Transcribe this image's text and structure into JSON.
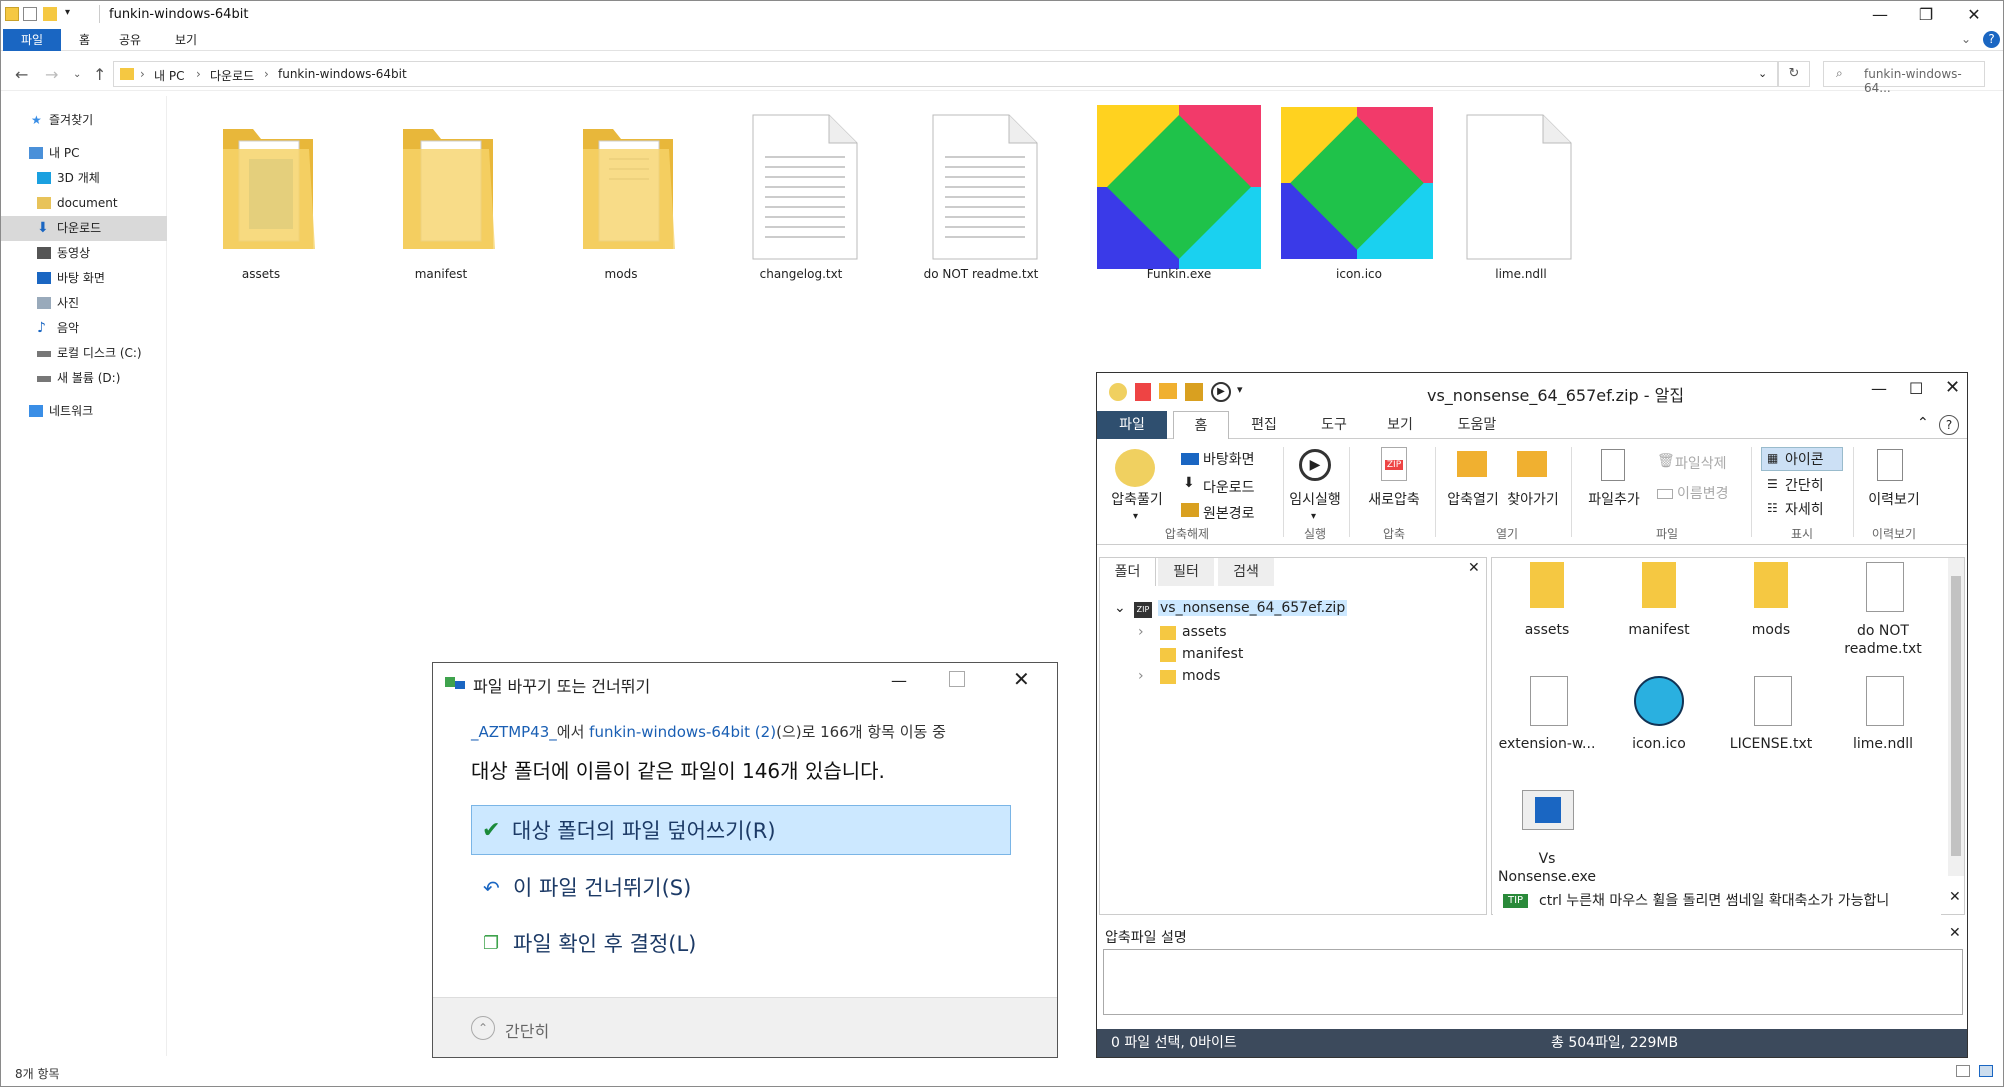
{
  "explorer": {
    "title": "funkin-windows-64bit",
    "ribbon_tabs": [
      "파일",
      "홈",
      "공유",
      "보기"
    ],
    "breadcrumb": [
      "내 PC",
      "다운로드",
      "funkin-windows-64bit"
    ],
    "search_placeholder": "funkin-windows-64...",
    "nav_items": [
      {
        "label": "즐겨찾기",
        "icon": "star-icon",
        "color": "#3a8ee6"
      },
      {
        "label": "내 PC",
        "icon": "pc-icon",
        "color": "#4a90d9"
      },
      {
        "label": "3D 개체",
        "icon": "cube-icon",
        "color": "#1aa0e0"
      },
      {
        "label": "document",
        "icon": "folder-icon",
        "color": "#e8c35a"
      },
      {
        "label": "다운로드",
        "icon": "download-icon",
        "color": "#1a66c2"
      },
      {
        "label": "동영상",
        "icon": "video-icon",
        "color": "#555"
      },
      {
        "label": "바탕 화면",
        "icon": "desktop-icon",
        "color": "#1a66c2"
      },
      {
        "label": "사진",
        "icon": "picture-icon",
        "color": "#888"
      },
      {
        "label": "음악",
        "icon": "music-icon",
        "color": "#1a66c2"
      },
      {
        "label": "로컬 디스크 (C:)",
        "icon": "drive-icon",
        "color": "#777"
      },
      {
        "label": "새 볼륨 (D:)",
        "icon": "drive-icon",
        "color": "#777"
      },
      {
        "label": "네트워크",
        "icon": "network-icon",
        "color": "#3a8ee6"
      }
    ],
    "files": [
      {
        "name": "assets",
        "type": "folder"
      },
      {
        "name": "manifest",
        "type": "folder"
      },
      {
        "name": "mods",
        "type": "folder"
      },
      {
        "name": "changelog.txt",
        "type": "text"
      },
      {
        "name": "do NOT readme.txt",
        "type": "text"
      },
      {
        "name": "Funkin.exe",
        "type": "exe"
      },
      {
        "name": "icon.ico",
        "type": "ico"
      },
      {
        "name": "lime.ndll",
        "type": "blank"
      }
    ],
    "status": "8개 항목"
  },
  "dialog": {
    "title": "파일 바꾸기 또는 건너뛰기",
    "source": "_AZTMP43_",
    "middle1": "에서",
    "target": "funkin-windows-64bit (2)",
    "middle2": "(으)로 166개 항목 이동 중",
    "message": "대상 폴더에 이름이 같은 파일이 146개 있습니다.",
    "options": [
      "대상 폴더의 파일 덮어쓰기(R)",
      "이 파일 건너뛰기(S)",
      "파일 확인 후 결정(L)"
    ],
    "collapse_label": "간단히"
  },
  "bandizip": {
    "title": "vs_nonsense_64_657ef.zip - 알집",
    "tabs": [
      "파일",
      "홈",
      "편집",
      "도구",
      "보기",
      "도움말"
    ],
    "ribbon": {
      "extract": "압축풀기",
      "to_desktop": "바탕화면",
      "to_downloads": "다운로드",
      "to_original": "원본경로",
      "group_extract": "압축해제",
      "temp_run": "임시실행",
      "group_run": "실행",
      "new_archive": "새로압축",
      "group_compress": "압축",
      "open_folder": "압축열기",
      "find": "찾아가기",
      "group_open": "열기",
      "add_file": "파일추가",
      "delete_file": "파일삭제",
      "rename": "이름변경",
      "group_file": "파일",
      "view_icon": "아이콘",
      "view_simple": "간단히",
      "view_detail": "자세히",
      "group_view": "표시",
      "history": "이력보기",
      "group_history": "이력보기"
    },
    "pane_tabs": [
      "폴더",
      "필터",
      "검색"
    ],
    "tree_root": "vs_nonsense_64_657ef.zip",
    "tree_children": [
      "assets",
      "manifest",
      "mods"
    ],
    "items": [
      {
        "name": "assets",
        "type": "folder"
      },
      {
        "name": "manifest",
        "type": "folder"
      },
      {
        "name": "mods",
        "type": "folder"
      },
      {
        "name": "do NOT readme.txt",
        "type": "text"
      },
      {
        "name": "extension-w...",
        "type": "blank"
      },
      {
        "name": "icon.ico",
        "type": "ico"
      },
      {
        "name": "LICENSE.txt",
        "type": "text"
      },
      {
        "name": "lime.ndll",
        "type": "blank"
      },
      {
        "name": "Vs Nonsense.exe",
        "type": "exe"
      }
    ],
    "tip_badge": "TIP",
    "tip_text": "ctrl 누른채 마우스 휠을 돌리면 썸네일 확대축소가 가능합니",
    "desc_label": "압축파일 설명",
    "status_left": "0 파일 선택, 0바이트",
    "status_right": "총 504파일, 229MB"
  },
  "colors": {
    "accent": "#1a66c2",
    "folder": "#f5c842",
    "select": "#cce8ff"
  }
}
